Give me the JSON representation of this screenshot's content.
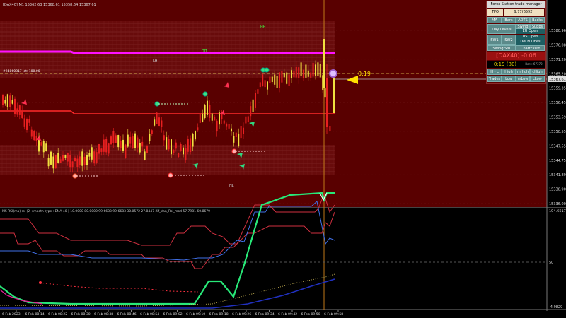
{
  "chart": {
    "header": "[DAX40],M1  15362.63 15368.61 15358.64 15367.61",
    "price_labels": [
      "15380.96",
      "15376.08",
      "15371.20",
      "15365.20",
      "15359.35",
      "15356.45",
      "15353.59",
      "15350.55",
      "15347.55",
      "15344.75",
      "15341.89",
      "15338.90",
      "15336.00"
    ],
    "current_price": "15367.61",
    "level_label": "#24860817 lot: 100.00",
    "countdown_label": "0:19",
    "zone_labels": {
      "top": "HH",
      "mid": "LH",
      "upper": "HH",
      "bottom": "HL"
    }
  },
  "indicator": {
    "header": "MS RSI(ma) rsi (2, smooth type : EMA  40 ) 10.0000 80.0000 99.6683 99.6683 30.0572 27.8447  2if_Van_Rsi_mod 57.7981 60.8679",
    "scale_labels": [
      "104.6517",
      "50",
      "-4.9829"
    ]
  },
  "time_axis": [
    "6 Feb 2023",
    "6 Feb 08:14",
    "6 Feb 08:22",
    "6 Feb 08:30",
    "6 Feb 08:38",
    "6 Feb 08:46",
    "6 Feb 08:54",
    "6 Feb 09:02",
    "6 Feb 09:10",
    "6 Feb 09:18",
    "6 Feb 09:26",
    "6 Feb 09:34",
    "6 Feb 09:42",
    "6 Feb 09:50",
    "6 Feb 09:58"
  ],
  "trade_manager": {
    "title": "Forex Station trade manager",
    "tpo_label": "TPO",
    "tpo_value": "9.77(6592)",
    "buttons": {
      "ma": "MA",
      "bars": "Bars",
      "adts": "ADTS",
      "backs": "Backs",
      "day_levels": "Day Levels",
      "swing": "Swing",
      "supps": "Supps",
      "eu_open": "EU Open",
      "sw1": "SW1",
      "sw2": "SW2",
      "us_open": "US Open",
      "del_h_lines": "Del H Lines",
      "swing_sr": "Swing S/R",
      "chart_fx_off": "ChartFxOff",
      "h_l": "H - L",
      "high": "High",
      "mhigh": "mHigh",
      "chigh": "cHigh",
      "trades": "Trades",
      "low": "Low",
      "mlow": "mLow",
      "clow": "cLow"
    },
    "symbol_value": "[DAX40] -0.06",
    "countdown": "0:19 (80)",
    "bars_count": "Bars: 67372"
  },
  "colors": {
    "upper_bg": "#590000",
    "candle_up": "#f0e040",
    "candle_down": "#e82020",
    "magenta_line": "#ff10ff",
    "red_line": "#ff2a2a",
    "vline": "#c07818",
    "rsi_green": "#28e878",
    "rsi_blue": "#4070e8",
    "rsi_red": "#d03040"
  }
}
